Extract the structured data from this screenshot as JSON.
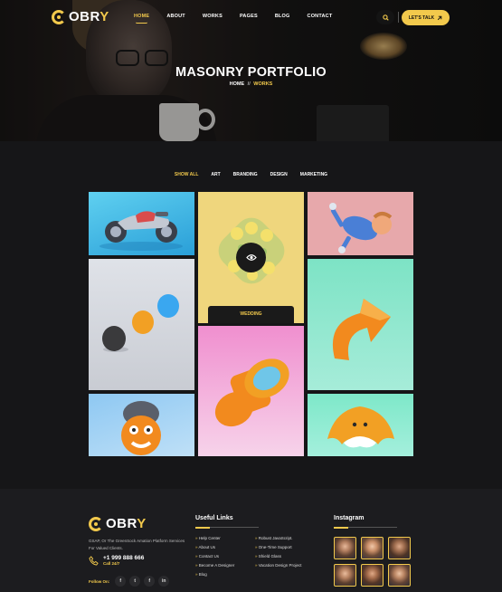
{
  "brand": {
    "logo_main": "OBR",
    "logo_accent": "Y",
    "accent_color": "#f2c94c"
  },
  "nav": {
    "items": [
      {
        "label": "HOME",
        "active": true
      },
      {
        "label": "ABOUT"
      },
      {
        "label": "WORKS"
      },
      {
        "label": "PAGES"
      },
      {
        "label": "BLOG"
      },
      {
        "label": "CONTACT"
      }
    ],
    "cta_label": "LET'S TALK"
  },
  "hero": {
    "title": "MASONRY PORTFOLIO",
    "breadcrumb_home": "HOME",
    "breadcrumb_sep": "//",
    "breadcrumb_current": "WORKS"
  },
  "filters": [
    "SHOW ALL",
    "ART",
    "BRANDING",
    "DESIGN",
    "MARKETING"
  ],
  "portfolio": {
    "hover_tag": "WEDDING",
    "tiles": [
      "motorbike",
      "yellow-toy",
      "falling-figure",
      "clay-balls",
      "orange-arrow",
      "orange-knob",
      "chef-character",
      "orange-cloud"
    ]
  },
  "footer": {
    "description": "GSAP, Or The GreenSock Amation Platform Services For Valued Clients.",
    "phone": "+1 999 888 666",
    "phone_sub": "Call 24/7",
    "follow_label": "Follow On:",
    "social": [
      "f",
      "t",
      "f",
      "in"
    ],
    "useful_links_title": "Useful Links",
    "links_left": [
      "Help Center",
      "About Us",
      "Contact Us",
      "Become A Designer",
      "Blog"
    ],
    "links_right": [
      "Robust JavaScript.",
      "One-Time Support",
      "Shield Glass",
      "Vacation Design Project"
    ],
    "instagram_title": "Instagram"
  }
}
